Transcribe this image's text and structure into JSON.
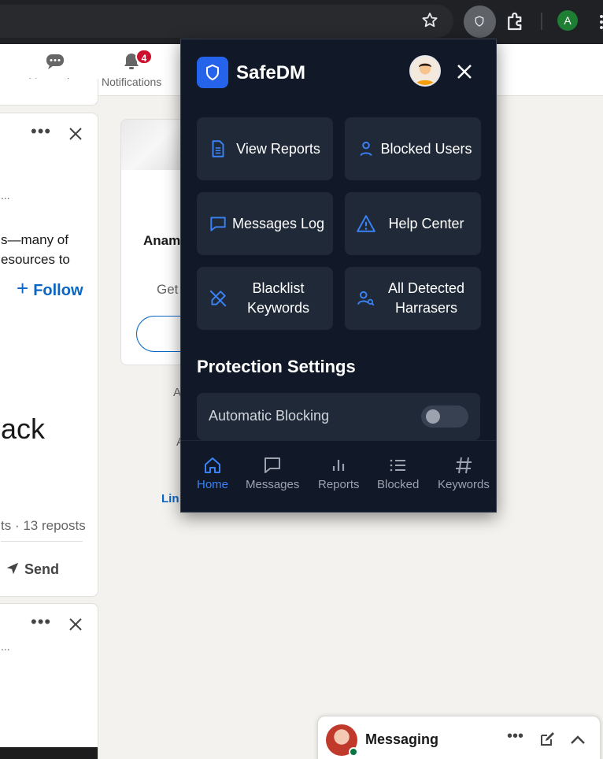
{
  "browser": {
    "profile_initial": "A"
  },
  "linkedin_nav": {
    "items": [
      {
        "label": "Messaging"
      },
      {
        "label": "Notifications",
        "badge": "4"
      }
    ]
  },
  "feed": {
    "follow_label": "Follow",
    "ellipsis": "...",
    "body_lines": [
      "s—many of",
      "esources to"
    ],
    "big_word": "ack",
    "reposts": "ts · 13 reposts",
    "send_label": "Send",
    "ellipsis2": "..."
  },
  "side": {
    "name_fragment": "Anam",
    "sub_fragment": "Get",
    "a1": "A",
    "a2": "A",
    "lin": "Lin"
  },
  "messaging_widget": {
    "label": "Messaging"
  },
  "safedm": {
    "title": "SafeDM",
    "brand_color": "#2563eb",
    "grid": [
      {
        "label": "View Reports",
        "icon": "document-icon"
      },
      {
        "label": "Blocked Users",
        "icon": "user-icon"
      },
      {
        "label": "Messages Log",
        "icon": "chat-icon"
      },
      {
        "label": "Help Center",
        "icon": "warning-icon"
      },
      {
        "label": "Blacklist Keywords",
        "icon": "pen-slash-icon"
      },
      {
        "label": "All Detected Harrasers",
        "icon": "user-search-icon"
      }
    ],
    "section_title": "Protection Settings",
    "settings": [
      {
        "label": "Automatic Blocking",
        "enabled": false
      }
    ],
    "footer_nav": [
      {
        "label": "Home",
        "icon": "home-icon",
        "active": true
      },
      {
        "label": "Messages",
        "icon": "message-icon",
        "active": false
      },
      {
        "label": "Reports",
        "icon": "bar-chart-icon",
        "active": false
      },
      {
        "label": "Blocked",
        "icon": "list-icon",
        "active": false
      },
      {
        "label": "Keywords",
        "icon": "hash-icon",
        "active": false
      }
    ]
  }
}
